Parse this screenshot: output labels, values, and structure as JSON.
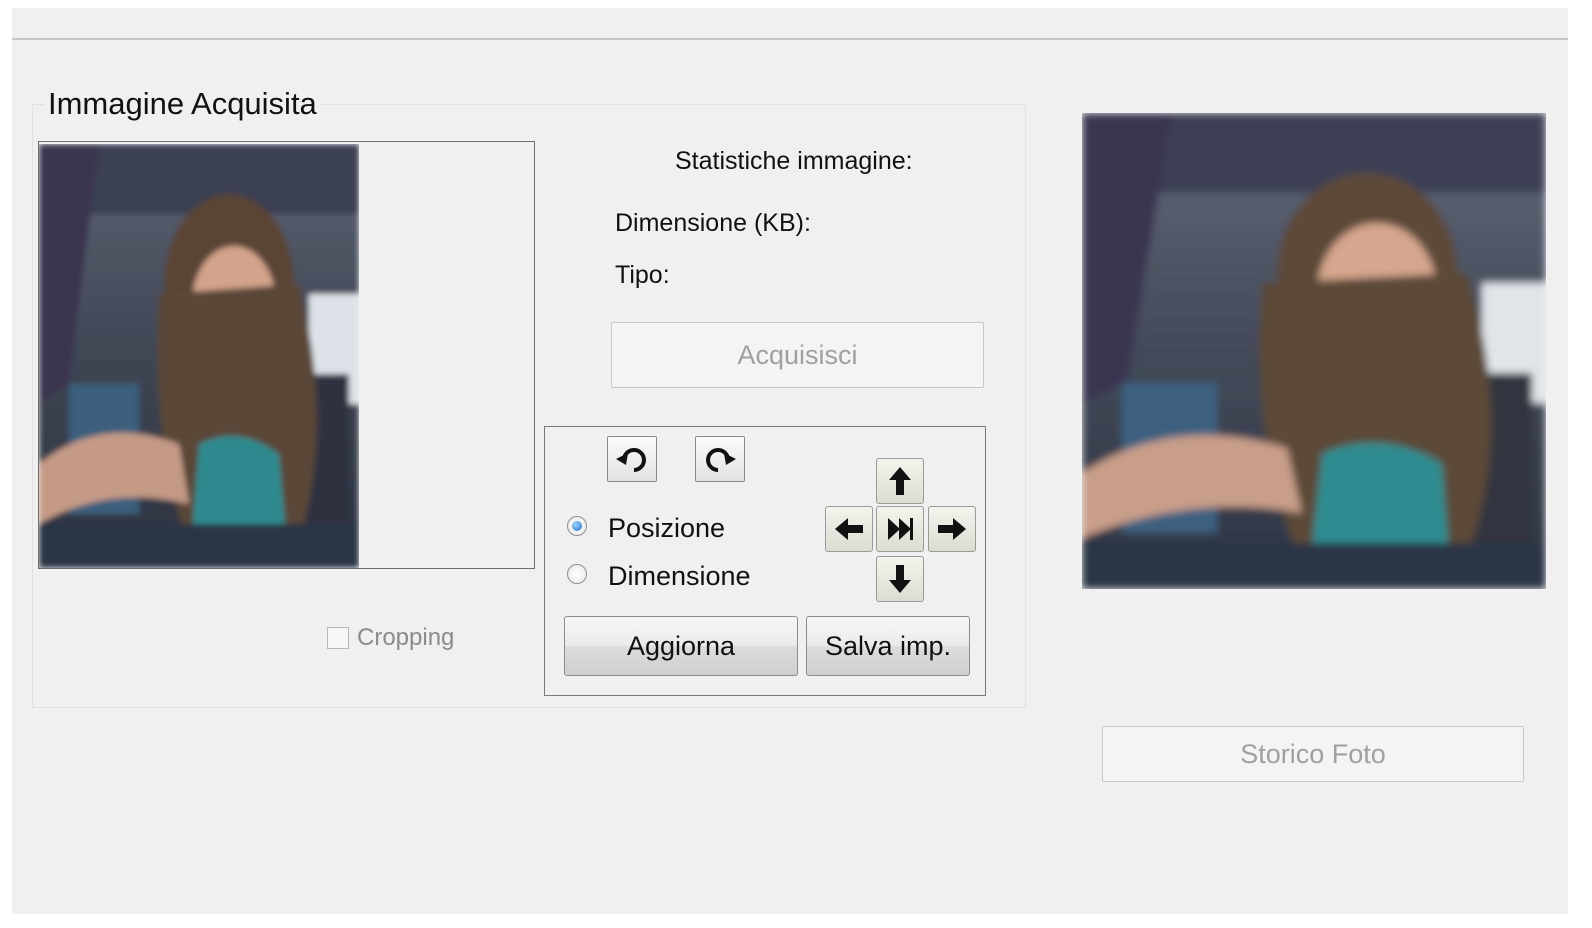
{
  "group": {
    "title": "Immagine Acquisita"
  },
  "stats": {
    "heading": "Statistiche immagine:",
    "size_label": "Dimensione (KB):",
    "type_label": "Tipo:"
  },
  "buttons": {
    "acquire": "Acquisisci",
    "update": "Aggiorna",
    "save_settings": "Salva imp.",
    "photo_history": "Storico Foto"
  },
  "mode": {
    "options": [
      {
        "label": "Posizione",
        "checked": true
      },
      {
        "label": "Dimensione",
        "checked": false
      }
    ]
  },
  "cropping": {
    "label": "Cropping",
    "checked": false,
    "enabled": false
  },
  "icons": {
    "rotate_left": "rotate-left-icon",
    "rotate_right": "rotate-right-icon",
    "up": "arrow-up-icon",
    "left": "arrow-left-icon",
    "center": "fast-forward-icon",
    "right": "arrow-right-icon",
    "down": "arrow-down-icon"
  }
}
